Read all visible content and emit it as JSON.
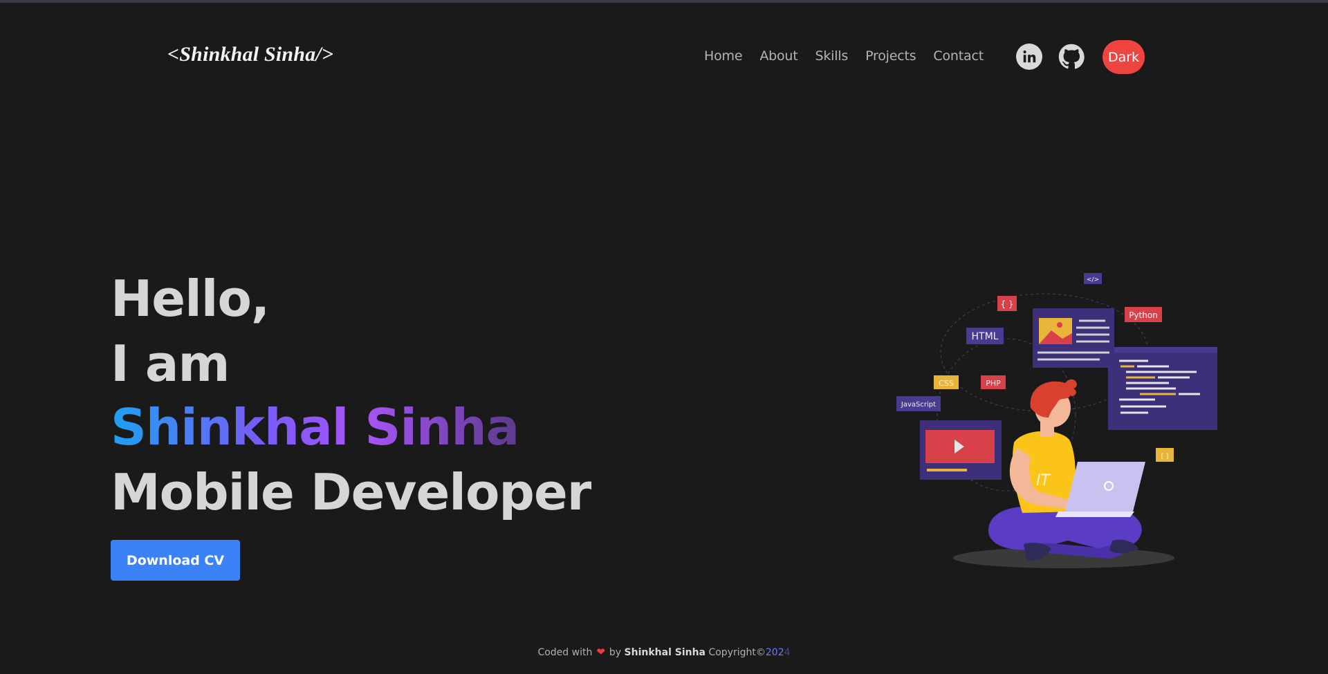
{
  "header": {
    "logo": "<Shinkhal Sinha/>",
    "nav": [
      "Home",
      "About",
      "Skills",
      "Projects",
      "Contact"
    ],
    "social": [
      {
        "name": "linkedin",
        "icon": "linkedin-icon"
      },
      {
        "name": "github",
        "icon": "github-icon"
      }
    ],
    "theme_button": "Dark"
  },
  "hero": {
    "greeting": "Hello,",
    "intro": "I am",
    "name": "Shinkhal Sinha",
    "role": "Mobile Developer",
    "cta": "Download CV"
  },
  "illustration": {
    "tags": [
      "HTML",
      "CSS",
      "PHP",
      "JavaScript",
      "Python",
      "{ }",
      "</>",
      "[ ]",
      "IT"
    ]
  },
  "footer": {
    "prefix": "Coded with",
    "heart": "❤",
    "by": "by",
    "name": "Shinkhal Sinha",
    "copyright": "Copyright©",
    "year_a": "202",
    "year_b": "4"
  },
  "colors": {
    "background": "#1a1a1a",
    "accent_blue": "#3b82f6",
    "dark_button": "#ee4540",
    "gradient_start": "#1da1f2",
    "gradient_end": "#5b3a8c"
  }
}
